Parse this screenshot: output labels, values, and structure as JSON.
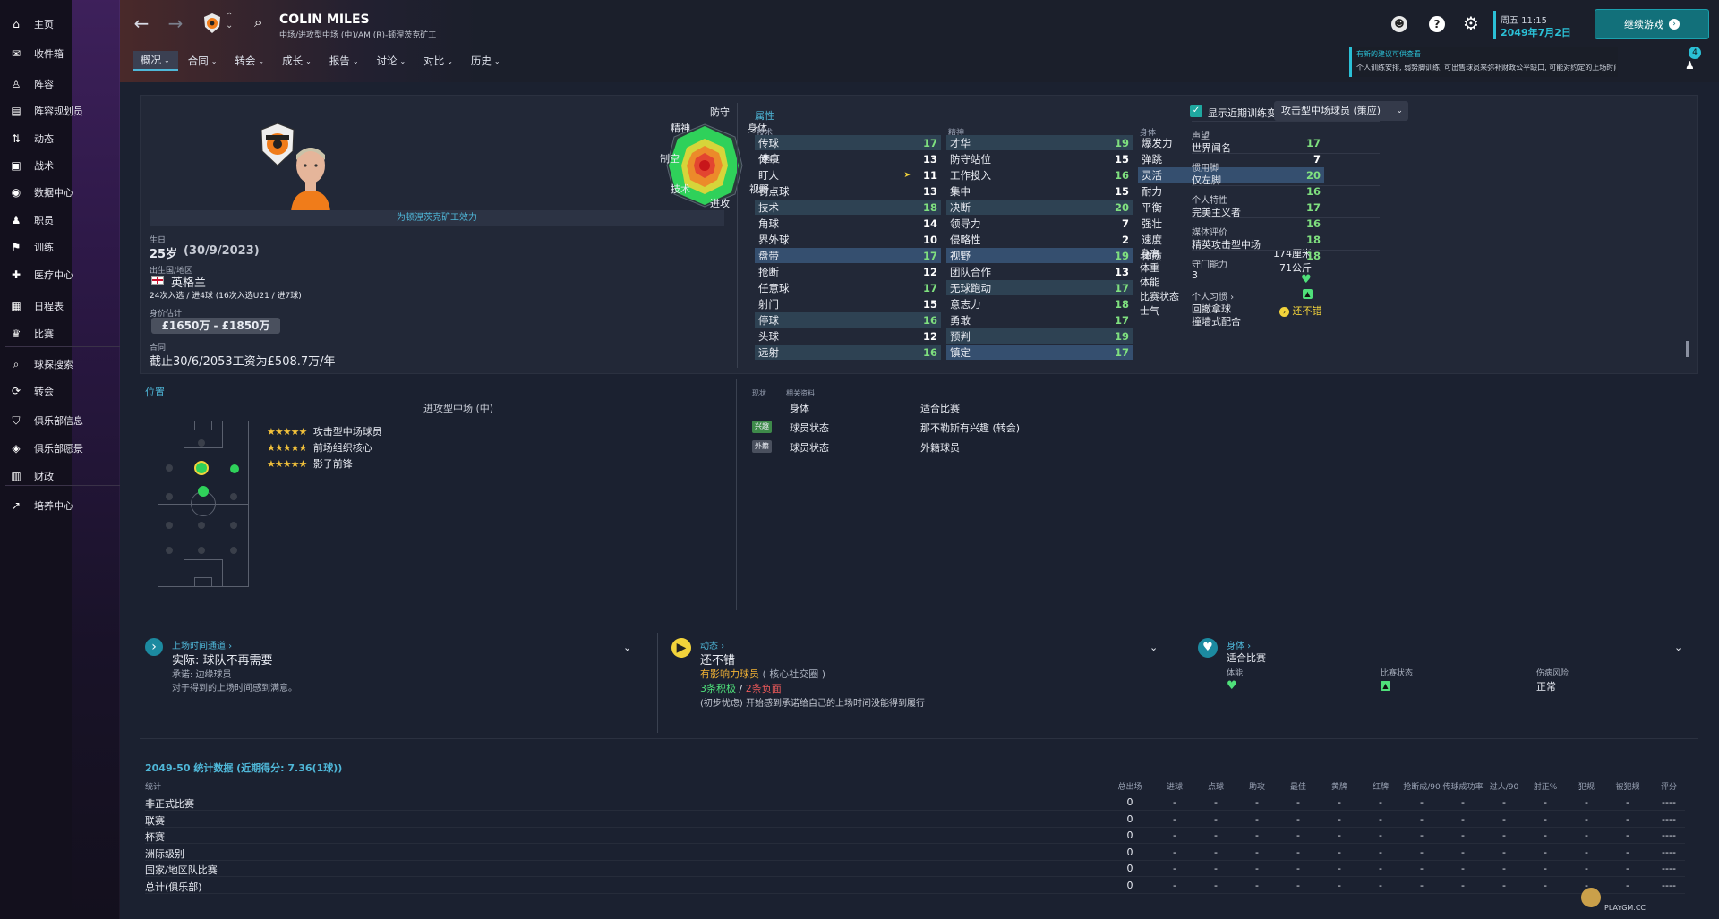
{
  "sidebar": {
    "items": [
      {
        "label": "主页",
        "icon": "home-icon"
      },
      {
        "label": "收件箱",
        "icon": "inbox-icon"
      },
      {
        "label": "阵容",
        "icon": "squad-icon"
      },
      {
        "label": "阵容规划员",
        "icon": "clipboard-icon"
      },
      {
        "label": "动态",
        "icon": "dynamics-icon"
      },
      {
        "label": "战术",
        "icon": "tactics-icon"
      },
      {
        "label": "数据中心",
        "icon": "data-icon"
      },
      {
        "label": "职员",
        "icon": "staff-icon"
      },
      {
        "label": "训练",
        "icon": "training-icon"
      },
      {
        "label": "医疗中心",
        "icon": "medical-icon"
      },
      {
        "label": "日程表",
        "icon": "calendar-icon"
      },
      {
        "label": "比赛",
        "icon": "trophy-icon"
      },
      {
        "label": "球探搜索",
        "icon": "search-icon"
      },
      {
        "label": "转会",
        "icon": "transfer-icon"
      },
      {
        "label": "俱乐部信息",
        "icon": "shield-icon"
      },
      {
        "label": "俱乐部愿景",
        "icon": "vision-icon"
      },
      {
        "label": "财政",
        "icon": "finance-icon"
      },
      {
        "label": "培养中心",
        "icon": "development-icon"
      }
    ]
  },
  "header": {
    "player_name": "COLIN MILES",
    "subtitle": "中场/进攻型中场 (中)/AM (R)-顿涅茨克矿工",
    "tabs": [
      "概况",
      "合同",
      "转会",
      "成长",
      "报告",
      "讨论",
      "对比",
      "历史"
    ],
    "date_day": "周五 11:15",
    "date": "2049年7月2日",
    "continue_label": "继续游戏",
    "notification_title": "有新的建议可供查看",
    "notification_text": "个人训练安排, 弱势脚训练, 可出售球员来弥补财政公平缺口, 可能对约定的上场时间感到不满",
    "notification_count": "4"
  },
  "profile": {
    "club_link": "为顿涅茨克矿工效力",
    "radar_labels": {
      "top": "防守",
      "tr": "身体",
      "r": "速度",
      "br": "视野",
      "bottom": "进攻",
      "bl": "技术",
      "l": "制空",
      "tl": "精神"
    },
    "birth_label": "生日",
    "age": "25岁",
    "birth_date": "(30/9/2023)",
    "nation_label": "出生国/地区",
    "nation": "英格兰",
    "caps": "24次入选 / 进4球 (16次入选U21 / 进7球)",
    "value_label": "身价估计",
    "value": "£1650万 - £1850万",
    "contract_label": "合同",
    "contract": "截止30/6/2053工资为£508.7万/年"
  },
  "attributes": {
    "title": "属性",
    "show_training_label": "显示近期训练变化",
    "role_select": "攻击型中场球员 (策应)",
    "technical_header": "技术",
    "mental_header": "精神",
    "physical_header": "身体",
    "technical": [
      {
        "name": "传球",
        "value": "17",
        "hl": "hl"
      },
      {
        "name": "传中",
        "value": "13"
      },
      {
        "name": "盯人",
        "value": "11",
        "arrow": true
      },
      {
        "name": "罚点球",
        "value": "13"
      },
      {
        "name": "技术",
        "value": "18",
        "hl": "hl"
      },
      {
        "name": "角球",
        "value": "14"
      },
      {
        "name": "界外球",
        "value": "10"
      },
      {
        "name": "盘带",
        "value": "17",
        "hl": "hl3"
      },
      {
        "name": "抢断",
        "value": "12"
      },
      {
        "name": "任意球",
        "value": "17"
      },
      {
        "name": "射门",
        "value": "15"
      },
      {
        "name": "停球",
        "value": "16",
        "hl": "hl"
      },
      {
        "name": "头球",
        "value": "12"
      },
      {
        "name": "远射",
        "value": "16",
        "hl": "hl"
      }
    ],
    "mental": [
      {
        "name": "才华",
        "value": "19",
        "hl": "hl"
      },
      {
        "name": "防守站位",
        "value": "15"
      },
      {
        "name": "工作投入",
        "value": "16"
      },
      {
        "name": "集中",
        "value": "15"
      },
      {
        "name": "决断",
        "value": "20",
        "hl": "hl"
      },
      {
        "name": "领导力",
        "value": "7"
      },
      {
        "name": "侵略性",
        "value": "2"
      },
      {
        "name": "视野",
        "value": "19",
        "hl": "hl3"
      },
      {
        "name": "团队合作",
        "value": "13"
      },
      {
        "name": "无球跑动",
        "value": "17",
        "hl": "hl"
      },
      {
        "name": "意志力",
        "value": "18"
      },
      {
        "name": "勇敢",
        "value": "17"
      },
      {
        "name": "预判",
        "value": "19",
        "hl": "hl"
      },
      {
        "name": "镇定",
        "value": "17",
        "hl": "hl3"
      }
    ],
    "physical": [
      {
        "name": "爆发力",
        "value": "17"
      },
      {
        "name": "弹跳",
        "value": "7"
      },
      {
        "name": "灵活",
        "value": "20",
        "hl": "hl3"
      },
      {
        "name": "耐力",
        "value": "16"
      },
      {
        "name": "平衡",
        "value": "17"
      },
      {
        "name": "强壮",
        "value": "16"
      },
      {
        "name": "速度",
        "value": "18"
      },
      {
        "name": "体质",
        "value": "18"
      }
    ],
    "height_label": "身高",
    "height": "174厘米",
    "weight_label": "体重",
    "weight": "71公斤",
    "fitness_label": "体能",
    "form_label": "比赛状态",
    "morale_label": "士气",
    "morale": "还不错"
  },
  "info": {
    "reputation_label": "声望",
    "reputation": "世界闻名",
    "foot_label": "惯用脚",
    "foot": "仅左脚",
    "personality_label": "个人特性",
    "personality": "完美主义者",
    "media_label": "媒体评价",
    "media": "精英攻击型中场",
    "gk_label": "守门能力",
    "gk": "3",
    "habits_label": "个人习惯",
    "habits": [
      "回撤拿球",
      "撞墙式配合"
    ]
  },
  "positions": {
    "title": "位置",
    "main_position": "进攻型中场 (中)",
    "roles": [
      {
        "stars": "★★★★★",
        "name": "攻击型中场球员"
      },
      {
        "stars": "★★★★★",
        "name": "前场组织核心"
      },
      {
        "stars": "★★★★★",
        "name": "影子前锋"
      }
    ]
  },
  "status": {
    "col1": "现状",
    "col2": "相关资料",
    "rows": [
      {
        "badge": "",
        "name": "身体",
        "value": "适合比赛"
      },
      {
        "badge": "兴趣",
        "name": "球员状态",
        "value": "那不勒斯有兴趣 (转会)"
      },
      {
        "badge": "外籍",
        "name": "球员状态",
        "value": "外籍球员"
      }
    ]
  },
  "cards": {
    "playtime": {
      "title": "上场时间通道",
      "main": "实际: 球队不再需要",
      "line1": "承诺: 边缘球员",
      "line2": "对于得到的上场时间感到满意。"
    },
    "dynamics": {
      "title": "动态",
      "main": "还不错",
      "influence": "有影响力球员",
      "group": "( 核心社交圈 )",
      "pos": "3条积极",
      "sep": "/",
      "neg": "2条负面",
      "note": "(初步忧虑) 开始感到承诺给自己的上场时间没能得到履行"
    },
    "physical": {
      "title": "身体",
      "main": "适合比赛",
      "fitness_label": "体能",
      "form_label": "比赛状态",
      "injury_label": "伤病风险",
      "injury": "正常"
    }
  },
  "stats": {
    "title": "2049-50 统计数据 (近期得分: 7.36(1球))",
    "row_header": "统计",
    "columns": [
      "总出场",
      "进球",
      "点球",
      "助攻",
      "最佳",
      "黄牌",
      "红牌",
      "抢断成/90",
      "传球成功率",
      "过人/90",
      "射正%",
      "犯规",
      "被犯规",
      "评分"
    ],
    "rows": [
      {
        "name": "非正式比赛",
        "values": [
          "0",
          "-",
          "-",
          "-",
          "-",
          "-",
          "-",
          "-",
          "-",
          "-",
          "-",
          "-",
          "-",
          "----"
        ]
      },
      {
        "name": "联赛",
        "values": [
          "0",
          "-",
          "-",
          "-",
          "-",
          "-",
          "-",
          "-",
          "-",
          "-",
          "-",
          "-",
          "-",
          "----"
        ]
      },
      {
        "name": "杯赛",
        "values": [
          "0",
          "-",
          "-",
          "-",
          "-",
          "-",
          "-",
          "-",
          "-",
          "-",
          "-",
          "-",
          "-",
          "----"
        ]
      },
      {
        "name": "洲际级别",
        "values": [
          "0",
          "-",
          "-",
          "-",
          "-",
          "-",
          "-",
          "-",
          "-",
          "-",
          "-",
          "-",
          "-",
          "----"
        ]
      },
      {
        "name": "国家/地区队比赛",
        "values": [
          "0",
          "-",
          "-",
          "-",
          "-",
          "-",
          "-",
          "-",
          "-",
          "-",
          "-",
          "-",
          "-",
          "----"
        ]
      },
      {
        "name": "总计(俱乐部)",
        "values": [
          "0",
          "-",
          "-",
          "-",
          "-",
          "-",
          "-",
          "-",
          "-",
          "-",
          "-",
          "-",
          "-",
          "----"
        ]
      }
    ]
  },
  "watermark": "PLAYGM.CC"
}
